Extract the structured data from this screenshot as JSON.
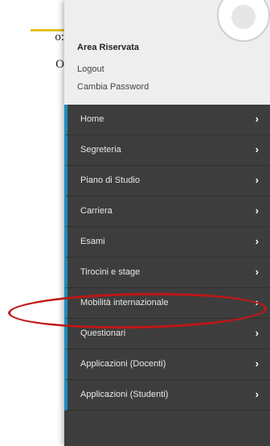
{
  "background": {
    "text_line_1": "o:",
    "text_line_2": "O"
  },
  "user_area": {
    "title": "Area Riservata",
    "logout": "Logout",
    "change_password": "Cambia Password"
  },
  "nav": {
    "items": [
      {
        "label": "Home"
      },
      {
        "label": "Segreteria"
      },
      {
        "label": "Piano di Studio"
      },
      {
        "label": "Carriera"
      },
      {
        "label": "Esami"
      },
      {
        "label": "Tirocini e stage"
      },
      {
        "label": "Mobilità internazionale"
      },
      {
        "label": "Questionari"
      },
      {
        "label": "Applicazioni (Docenti)"
      },
      {
        "label": "Applicazioni (Studenti)"
      }
    ],
    "chevron": "›"
  },
  "colors": {
    "sidebar_bg": "#3d3d3d",
    "accent": "#1a8fc0",
    "highlight": "#c01616",
    "underline": "#e2c21a"
  }
}
